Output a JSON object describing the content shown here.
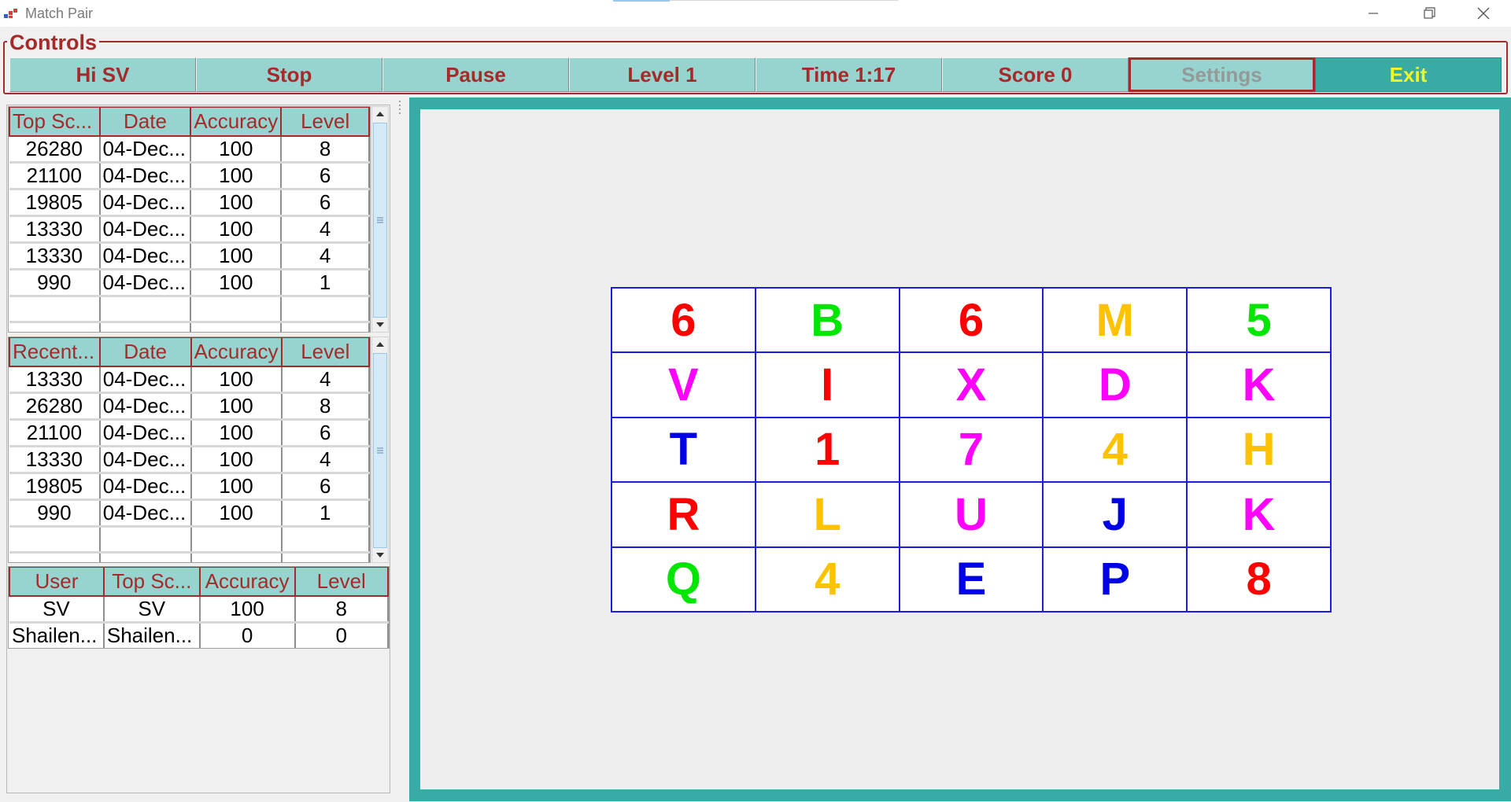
{
  "window": {
    "title": "Match Pair"
  },
  "controls": {
    "legend": "Controls",
    "buttons": [
      {
        "label": "Hi SV",
        "state": "normal"
      },
      {
        "label": "Stop",
        "state": "normal"
      },
      {
        "label": "Pause",
        "state": "normal"
      },
      {
        "label": "Level 1",
        "state": "normal"
      },
      {
        "label": "Time 1:17",
        "state": "normal"
      },
      {
        "label": "Score 0",
        "state": "normal"
      },
      {
        "label": "Settings",
        "state": "disabled"
      },
      {
        "label": "Exit",
        "state": "exit"
      }
    ]
  },
  "top_scores": {
    "headers": [
      "Top Sc...",
      "Date",
      "Accuracy",
      "Level"
    ],
    "rows": [
      [
        "26280",
        "04-Dec...",
        "100",
        "8"
      ],
      [
        "21100",
        "04-Dec...",
        "100",
        "6"
      ],
      [
        "19805",
        "04-Dec...",
        "100",
        "6"
      ],
      [
        "13330",
        "04-Dec...",
        "100",
        "4"
      ],
      [
        "13330",
        "04-Dec...",
        "100",
        "4"
      ],
      [
        "990",
        "04-Dec...",
        "100",
        "1"
      ]
    ]
  },
  "recent_scores": {
    "headers": [
      "Recent...",
      "Date",
      "Accuracy",
      "Level"
    ],
    "rows": [
      [
        "13330",
        "04-Dec...",
        "100",
        "4"
      ],
      [
        "26280",
        "04-Dec...",
        "100",
        "8"
      ],
      [
        "21100",
        "04-Dec...",
        "100",
        "6"
      ],
      [
        "13330",
        "04-Dec...",
        "100",
        "4"
      ],
      [
        "19805",
        "04-Dec...",
        "100",
        "6"
      ],
      [
        "990",
        "04-Dec...",
        "100",
        "1"
      ]
    ]
  },
  "users": {
    "headers": [
      "User",
      "Top Sc...",
      "Accuracy",
      "Level"
    ],
    "rows": [
      [
        "SV",
        "SV",
        "100",
        "8"
      ],
      [
        "Shailen...",
        "Shailen...",
        "0",
        "0"
      ]
    ]
  },
  "board": {
    "colors": {
      "red": "#ff0000",
      "green": "#00e600",
      "orange": "#ffc200",
      "magenta": "#ff00ff",
      "blue": "#0000e6"
    },
    "tiles": [
      {
        "char": "6",
        "color": "red"
      },
      {
        "char": "B",
        "color": "green"
      },
      {
        "char": "6",
        "color": "red"
      },
      {
        "char": "M",
        "color": "orange"
      },
      {
        "char": "5",
        "color": "green"
      },
      {
        "char": "V",
        "color": "magenta"
      },
      {
        "char": "I",
        "color": "red"
      },
      {
        "char": "X",
        "color": "magenta"
      },
      {
        "char": "D",
        "color": "magenta"
      },
      {
        "char": "K",
        "color": "magenta"
      },
      {
        "char": "T",
        "color": "blue"
      },
      {
        "char": "1",
        "color": "red"
      },
      {
        "char": "7",
        "color": "magenta"
      },
      {
        "char": "4",
        "color": "orange"
      },
      {
        "char": "H",
        "color": "orange"
      },
      {
        "char": "R",
        "color": "red"
      },
      {
        "char": "L",
        "color": "orange"
      },
      {
        "char": "U",
        "color": "magenta"
      },
      {
        "char": "J",
        "color": "blue"
      },
      {
        "char": "K",
        "color": "magenta"
      },
      {
        "char": "Q",
        "color": "green"
      },
      {
        "char": "4",
        "color": "orange"
      },
      {
        "char": "E",
        "color": "blue"
      },
      {
        "char": "P",
        "color": "blue"
      },
      {
        "char": "8",
        "color": "red"
      }
    ]
  }
}
